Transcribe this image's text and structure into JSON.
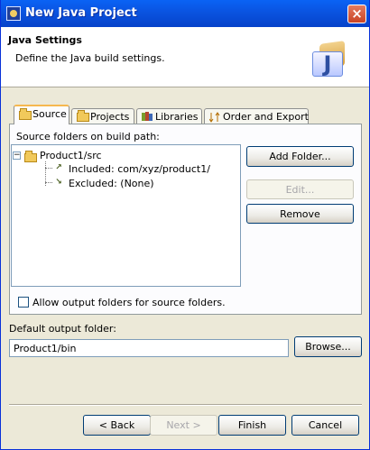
{
  "window": {
    "title": "New Java Project"
  },
  "header": {
    "title": "Java Settings",
    "description": "Define the Java build settings."
  },
  "tabs": [
    {
      "label": "Source",
      "icon": "source-folder-icon",
      "active": true
    },
    {
      "label": "Projects",
      "icon": "projects-folder-icon",
      "active": false
    },
    {
      "label": "Libraries",
      "icon": "libraries-icon",
      "active": false
    },
    {
      "label": "Order and Export",
      "icon": "order-export-icon",
      "active": false
    }
  ],
  "source": {
    "tree_label": "Source folders on build path:",
    "root": "Product1/src",
    "children": [
      {
        "label": "Included: com/xyz/product1/",
        "icon": "included-icon"
      },
      {
        "label": "Excluded: (None)",
        "icon": "excluded-icon"
      }
    ],
    "buttons": {
      "add": "Add Folder...",
      "edit": "Edit...",
      "remove": "Remove"
    },
    "checkbox_label": "Allow output folders for source folders."
  },
  "output": {
    "label": "Default output folder:",
    "value": "Product1/bin",
    "browse": "Browse..."
  },
  "footer": {
    "back": "< Back",
    "next": "Next >",
    "finish": "Finish",
    "cancel": "Cancel"
  },
  "colors": {
    "title_bar": "#0a53e0",
    "dialog_bg": "#ece9d8",
    "active_tab_top": "#f6b84f"
  }
}
